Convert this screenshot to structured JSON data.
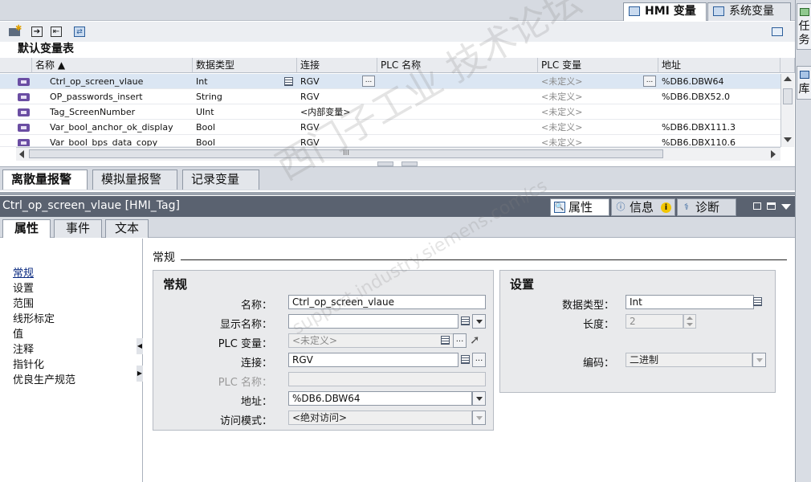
{
  "top_tabs": [
    {
      "label": "HMI 变量",
      "icon": "hmi-tag-table-icon"
    },
    {
      "label": "系统变量",
      "icon": "system-tag-table-icon"
    }
  ],
  "right_strip": [
    "任务",
    "库"
  ],
  "toolbar": {
    "buttons": [
      "add-tag-icon",
      "export-icon",
      "import-icon",
      "goto-connection-icon"
    ],
    "right_button": "panel-toggle-icon"
  },
  "table_title": "默认变量表",
  "tag_table": {
    "columns": [
      "名称 ▲",
      "数据类型",
      "连接",
      "PLC 名称",
      "PLC 变量",
      "地址"
    ],
    "rows": [
      {
        "name": "Ctrl_op_screen_vlaue",
        "type": "Int",
        "connection": "RGV",
        "plc_name": "",
        "plc_tag": "<未定义>",
        "address": "%DB6.DBW64",
        "selected": true
      },
      {
        "name": "OP_passwords_insert",
        "type": "String",
        "connection": "RGV",
        "plc_name": "",
        "plc_tag": "<未定义>",
        "address": "%DB6.DBX52.0",
        "selected": false
      },
      {
        "name": "Tag_ScreenNumber",
        "type": "UInt",
        "connection": "<内部变量>",
        "plc_name": "",
        "plc_tag": "<未定义>",
        "address": "",
        "selected": false
      },
      {
        "name": "Var_bool_anchor_ok_display",
        "type": "Bool",
        "connection": "RGV",
        "plc_name": "",
        "plc_tag": "<未定义>",
        "address": "%DB6.DBX111.3",
        "selected": false
      },
      {
        "name": "Var_bool_bps_data_copy",
        "type": "Bool",
        "connection": "RGV",
        "plc_name": "",
        "plc_tag": "<未定义>",
        "address": "%DB6.DBX110.6",
        "selected": false
      }
    ],
    "hscroll_label": "III",
    "cell_button": "..."
  },
  "bottom_tabs": [
    "离散量报警",
    "模拟量报警",
    "记录变量"
  ],
  "inspector": {
    "title": "Ctrl_op_screen_vlaue [HMI_Tag]",
    "tabs": [
      {
        "label": "属性",
        "icon": "properties-icon"
      },
      {
        "label": "信息",
        "icon": "info-icon"
      },
      {
        "label": "诊断",
        "icon": "diagnostics-icon"
      }
    ],
    "sub_tabs": [
      "属性",
      "事件",
      "文本"
    ],
    "nav": [
      "常规",
      "设置",
      "范围",
      "线形标定",
      "值",
      "注释",
      "指针化",
      "优良生产规范"
    ],
    "section_title": "常规",
    "general": {
      "title": "常规",
      "name_label": "名称：",
      "name_value": "Ctrl_op_screen_vlaue",
      "display_label": "显示名称：",
      "display_value": "",
      "plc_tag_label": "PLC 变量：",
      "plc_tag_value": "<未定义>",
      "connection_label": "连接：",
      "connection_value": "RGV",
      "plc_name_label": "PLC 名称：",
      "plc_name_value": "",
      "address_label": "地址：",
      "address_value": "%DB6.DBW64",
      "access_label": "访问模式：",
      "access_value": "<绝对访问>",
      "button_dots": "..."
    },
    "settings": {
      "title": "设置",
      "type_label": "数据类型：",
      "type_value": "Int",
      "length_label": "长度：",
      "length_value": "2",
      "encoding_label": "编码：",
      "encoding_value": "二进制"
    }
  },
  "watermark": {
    "line1": "西门子工业 技术论坛",
    "line2": "support.industry.siemens.com/cs"
  },
  "colors": {
    "inspector_title_bg": "#5a6270",
    "selected_row": "#dbe6f3",
    "tag_icon": "#6b4ea3"
  }
}
